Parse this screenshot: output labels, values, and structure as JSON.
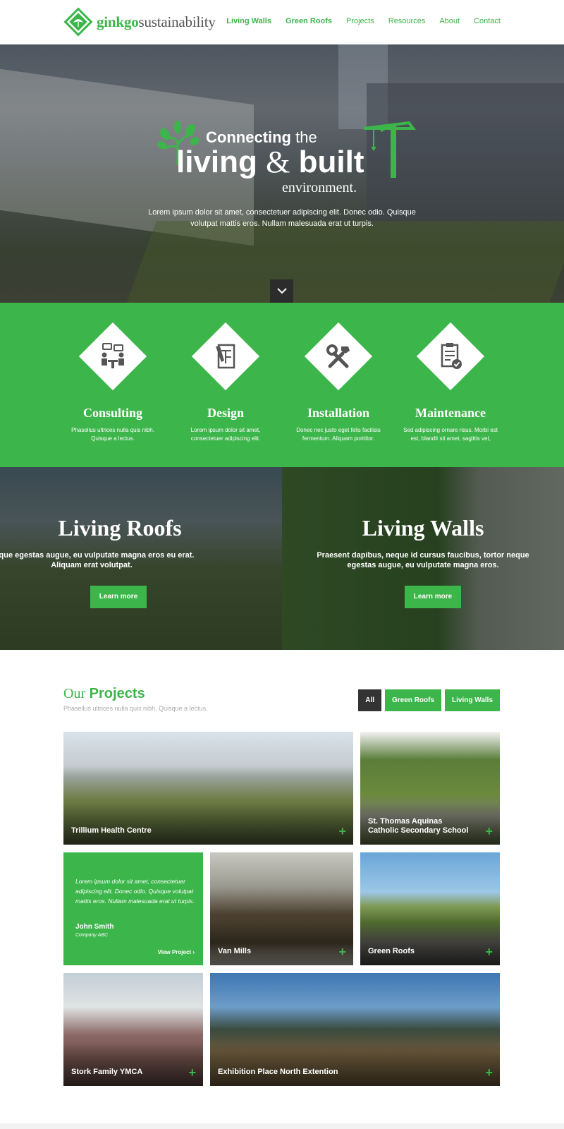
{
  "brand": {
    "name_bold": "ginkgo",
    "name_rest": "sustainability",
    "accent": "#3cb54a",
    "logo_icon": "ginkgo-leaf-icon"
  },
  "nav": [
    {
      "label": "Living Walls",
      "bold": true
    },
    {
      "label": "Green Roofs",
      "bold": true
    },
    {
      "label": "Projects",
      "bold": false
    },
    {
      "label": "Resources",
      "bold": false
    },
    {
      "label": "About",
      "bold": false
    },
    {
      "label": "Contact",
      "bold": false
    }
  ],
  "hero": {
    "line1_bold": "Connecting",
    "line1_rest": "the",
    "line2_a": "living",
    "line2_amp": "&",
    "line2_b": "built",
    "line3": "environment.",
    "description": "Lorem ipsum dolor sit amet, consectetuer adipiscing elit. Donec odio. Quisque volutpat mattis eros. Nullam malesuada erat ut turpis.",
    "scroll_icon": "chevron-down-icon"
  },
  "services": [
    {
      "title": "Consulting",
      "desc": "Phasellus ultrices nulla quis nibh. Quisque a lectus.",
      "icon": "meeting-icon"
    },
    {
      "title": "Design",
      "desc": "Lorem ipsum dolor sit amet, consectetuer adipiscing elit.",
      "icon": "blueprint-icon"
    },
    {
      "title": "Installation",
      "desc": "Donec nec justo eget felis facilisis fermentum. Aliquam porttitor.",
      "icon": "tools-icon"
    },
    {
      "title": "Maintenance",
      "desc": "Sed adipiscing ornare risus. Morbi est est, blandit sit amet, sagittis vel,",
      "icon": "clipboard-check-icon"
    }
  ],
  "panels": [
    {
      "title": "Living Roofs",
      "sub": "Neque egestas augue, eu vulputate magna eros eu erat. Aliquam erat volutpat.",
      "button": "Learn more"
    },
    {
      "title": "Living Walls",
      "sub": "Praesent dapibus, neque id cursus faucibus, tortor neque egestas augue, eu vulputate magna eros.",
      "button": "Learn more"
    }
  ],
  "projects": {
    "title_our": "Our",
    "title_projects": "Projects",
    "subtitle": "Phasellus ultrices nulla quis nibh. Quisque a lectus.",
    "filters": [
      {
        "label": "All",
        "active": true
      },
      {
        "label": "Green Roofs",
        "active": false
      },
      {
        "label": "Living Walls",
        "active": false
      }
    ],
    "tiles": [
      {
        "caption": "Trillium Health Centre"
      },
      {
        "caption": "St. Thomas Aquinas\nCatholic Secondary School"
      },
      {
        "caption": "Van Mills"
      },
      {
        "caption": "Green Roofs"
      },
      {
        "caption": "Stork Family YMCA"
      },
      {
        "caption": "Exhibition Place North Extention"
      }
    ],
    "plus_label": "+",
    "testimonial": {
      "quote": "Lorem ipsum dolor sit amet, consectetuer adipiscing elit. Donec odio. Quisque volutpat mattis eros. Nullam malesuada erat ut turpis.",
      "name": "John Smith",
      "company": "Company ABC",
      "link": "View Project"
    }
  }
}
